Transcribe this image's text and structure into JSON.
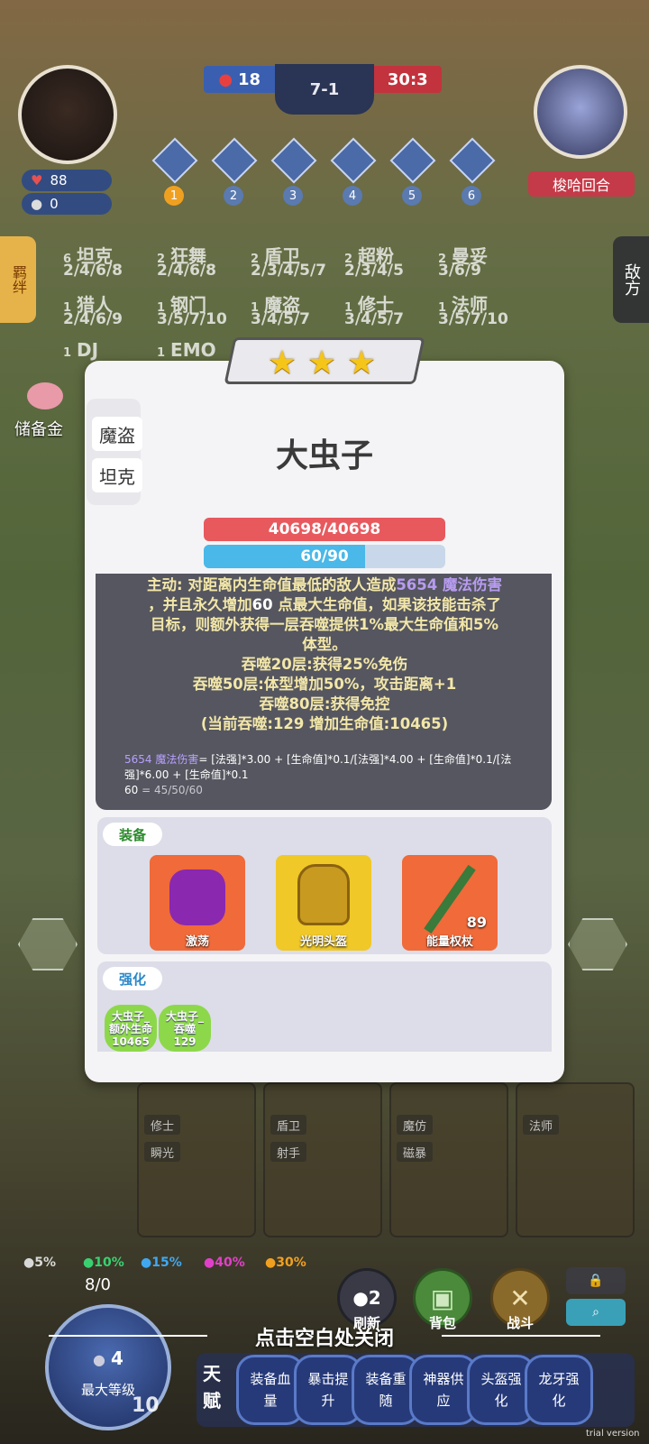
{
  "top": {
    "left_score": "18",
    "stage": "7-1",
    "right_score": "30:3",
    "round_label": "梭哈回合",
    "hp": "88",
    "coins": "0",
    "trophy_numbers": [
      "1",
      "2",
      "3",
      "4",
      "5",
      "6"
    ]
  },
  "synergy": {
    "rows": [
      [
        {
          "count": "6",
          "name": "坦克",
          "steps": "2/4/6/8"
        },
        {
          "count": "2",
          "name": "狂舞",
          "steps": "2/4/6/8"
        },
        {
          "count": "2",
          "name": "盾卫",
          "steps": "2/3/4/5/7"
        },
        {
          "count": "2",
          "name": "超粉",
          "steps": "2/3/4/5"
        },
        {
          "count": "2",
          "name": "曼妥",
          "steps": "3/6/9"
        }
      ],
      [
        {
          "count": "1",
          "name": "猎人",
          "steps": "2/4/6/9"
        },
        {
          "count": "1",
          "name": "钢门",
          "steps": "3/5/7/10"
        },
        {
          "count": "1",
          "name": "魔盗",
          "steps": "3/4/5/7"
        },
        {
          "count": "1",
          "name": "修士",
          "steps": "3/4/5/7"
        },
        {
          "count": "1",
          "name": "法师",
          "steps": "3/5/7/10"
        }
      ],
      [
        {
          "count": "1",
          "name": "DJ",
          "steps": ""
        },
        {
          "count": "1",
          "name": "EMO",
          "steps": ""
        }
      ]
    ],
    "left_tab": "羁绊",
    "right_tab": "敌方",
    "reserve_label": "储备金"
  },
  "popup": {
    "stars": 3,
    "traits": [
      "魔盗",
      "坦克"
    ],
    "hero_name": "大虫子",
    "hp_text": "40698/40698",
    "mana_text": "60/90",
    "mana_fraction": 0.667,
    "skill": {
      "line1_a": "主动: 对距离内生命值最低的敌人造成",
      "line1_dmg": "5654 魔法伤害",
      "line2_a": "，并且永久增加",
      "line2_num": "60",
      "line2_b": "点最大生命值，如果该技能击杀了",
      "line3": "目标，则额外获得一层吞噬提供1%最大生命值和5%",
      "line4": "体型。",
      "line5": "吞噬20层:获得25%免伤",
      "line6": "吞噬50层:体型增加50%，攻击距离+1",
      "line7": "吞噬80层:获得免控",
      "line8": "(当前吞噬:129 增加生命值:10465)"
    },
    "formula": {
      "dmg_label": "5654 魔法伤害",
      "dmg_expr": "= [法强]*3.00 + [生命值]*0.1/[法强]*4.00 + [生命值]*0.1/[法强]*6.00 + [生命值]*0.1",
      "hp_label": "60",
      "hp_expr": "= 45/50/60"
    },
    "equip_title": "装备",
    "items": [
      {
        "name": "激荡",
        "color": "#f06a3a",
        "num": ""
      },
      {
        "name": "光明头盔",
        "color": "#f0c828",
        "num": ""
      },
      {
        "name": "能量权杖",
        "color": "#f06a3a",
        "num": "89"
      }
    ],
    "enhance_title": "强化",
    "enhancements": [
      {
        "line1": "大虫子_",
        "line2": "额外生命",
        "line3": "10465"
      },
      {
        "line1": "大虫子_",
        "line2": "吞噬",
        "line3": "129"
      }
    ]
  },
  "cards": [
    {
      "tags": [
        "修士",
        "瞬光"
      ]
    },
    {
      "tags": [
        "盾卫",
        "射手"
      ]
    },
    {
      "tags": [
        "魔仿",
        "磁暴"
      ]
    },
    {
      "tags": [
        "法师",
        ""
      ]
    }
  ],
  "bottom": {
    "odds": [
      {
        "pct": "5%",
        "color": "#d8d8d8"
      },
      {
        "pct": "10%",
        "color": "#3ad070"
      },
      {
        "pct": "15%",
        "color": "#40a8f0"
      },
      {
        "pct": "40%",
        "color": "#e040c8"
      },
      {
        "pct": "30%",
        "color": "#f0a020"
      }
    ],
    "xp": "8/0",
    "coin_cost": "4",
    "level_label": "最大等级",
    "level": "10",
    "refresh_cost": "2",
    "refresh_label": "刷新",
    "bag_label": "背包",
    "battle_label": "战斗",
    "close_hint": "点击空白处关闭",
    "talent_label": "天赋",
    "talents": [
      "装备血量",
      "暴击提升",
      "装备重随",
      "神器供应",
      "头盔强化",
      "龙牙强化"
    ],
    "trial": "trial version"
  }
}
